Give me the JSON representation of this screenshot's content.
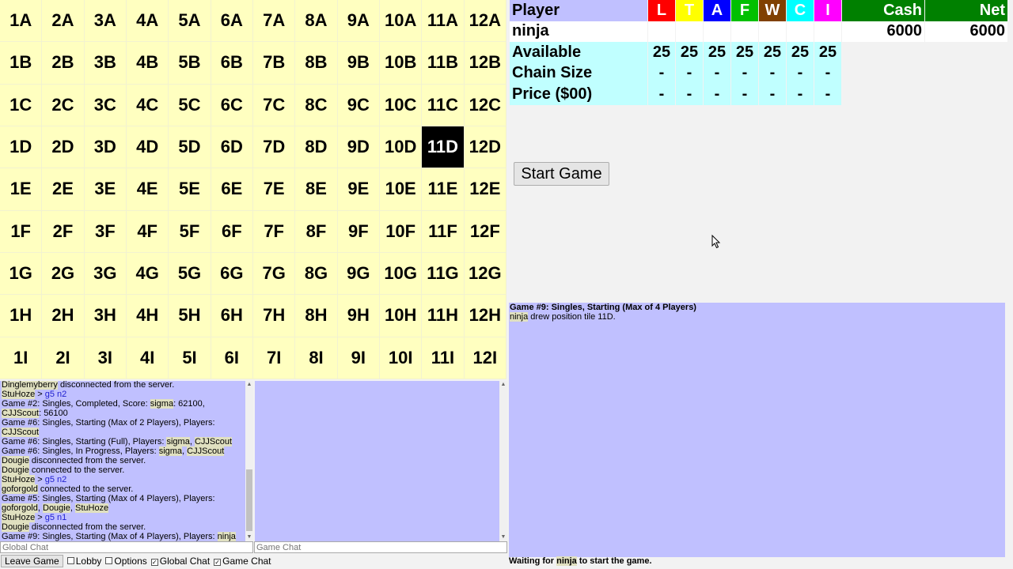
{
  "board": {
    "rows": [
      [
        "1A",
        "2A",
        "3A",
        "4A",
        "5A",
        "6A",
        "7A",
        "8A",
        "9A",
        "10A",
        "11A",
        "12A"
      ],
      [
        "1B",
        "2B",
        "3B",
        "4B",
        "5B",
        "6B",
        "7B",
        "8B",
        "9B",
        "10B",
        "11B",
        "12B"
      ],
      [
        "1C",
        "2C",
        "3C",
        "4C",
        "5C",
        "6C",
        "7C",
        "8C",
        "9C",
        "10C",
        "11C",
        "12C"
      ],
      [
        "1D",
        "2D",
        "3D",
        "4D",
        "5D",
        "6D",
        "7D",
        "8D",
        "9D",
        "10D",
        "11D",
        "12D"
      ],
      [
        "1E",
        "2E",
        "3E",
        "4E",
        "5E",
        "6E",
        "7E",
        "8E",
        "9E",
        "10E",
        "11E",
        "12E"
      ],
      [
        "1F",
        "2F",
        "3F",
        "4F",
        "5F",
        "6F",
        "7F",
        "8F",
        "9F",
        "10F",
        "11F",
        "12F"
      ],
      [
        "1G",
        "2G",
        "3G",
        "4G",
        "5G",
        "6G",
        "7G",
        "8G",
        "9G",
        "10G",
        "11G",
        "12G"
      ],
      [
        "1H",
        "2H",
        "3H",
        "4H",
        "5H",
        "6H",
        "7H",
        "8H",
        "9H",
        "10H",
        "11H",
        "12H"
      ],
      [
        "1I",
        "2I",
        "3I",
        "4I",
        "5I",
        "6I",
        "7I",
        "8I",
        "9I",
        "10I",
        "11I",
        "12I"
      ]
    ],
    "drawn_tile": "11D"
  },
  "score": {
    "player_header": "Player",
    "chains": [
      {
        "letter": "L",
        "color": "#ff0000"
      },
      {
        "letter": "T",
        "color": "#ffff00"
      },
      {
        "letter": "A",
        "color": "#0000ff"
      },
      {
        "letter": "F",
        "color": "#00c000"
      },
      {
        "letter": "W",
        "color": "#804000"
      },
      {
        "letter": "C",
        "color": "#00ffff"
      },
      {
        "letter": "I",
        "color": "#ff00ff"
      }
    ],
    "cash_header": "Cash",
    "net_header": "Net",
    "players": [
      {
        "name": "ninja",
        "holdings": [
          "",
          "",
          "",
          "",
          "",
          "",
          ""
        ],
        "cash": "6000",
        "net": "6000"
      }
    ],
    "rows": [
      {
        "label": "Available",
        "values": [
          "25",
          "25",
          "25",
          "25",
          "25",
          "25",
          "25"
        ]
      },
      {
        "label": "Chain Size",
        "values": [
          "-",
          "-",
          "-",
          "-",
          "-",
          "-",
          "-"
        ]
      },
      {
        "label": "Price ($00)",
        "values": [
          "-",
          "-",
          "-",
          "-",
          "-",
          "-",
          "-"
        ]
      }
    ]
  },
  "start_button": "Start Game",
  "global_chat": [
    [
      {
        "t": "Dinglemyberry",
        "hl": true
      },
      {
        "t": " disconnected from the server."
      }
    ],
    [
      {
        "t": "StuHoze",
        "hl": true
      },
      {
        "t": " > "
      },
      {
        "t": "g5 n2",
        "cmd": true
      }
    ],
    [
      {
        "t": "Game #2: Singles, Completed, Score: "
      },
      {
        "t": "sigma",
        "hl": true
      },
      {
        "t": ": 62100, "
      },
      {
        "t": "CJJScout",
        "hl": true
      },
      {
        "t": ": 56100"
      }
    ],
    [
      {
        "t": "Game #6: Singles, Starting (Max of 2 Players), Players: "
      },
      {
        "t": "CJJScout",
        "hl": true
      }
    ],
    [
      {
        "t": "Game #6: Singles, Starting (Full), Players: "
      },
      {
        "t": "sigma",
        "hl": true
      },
      {
        "t": ", "
      },
      {
        "t": "CJJScout",
        "hl": true
      }
    ],
    [
      {
        "t": "Game #6: Singles, In Progress, Players: "
      },
      {
        "t": "sigma",
        "hl": true
      },
      {
        "t": ", "
      },
      {
        "t": "CJJScout",
        "hl": true
      }
    ],
    [
      {
        "t": "Dougie",
        "hl": true
      },
      {
        "t": " disconnected from the server."
      }
    ],
    [
      {
        "t": "Dougie",
        "hl": true
      },
      {
        "t": " connected to the server."
      }
    ],
    [
      {
        "t": "StuHoze",
        "hl": true
      },
      {
        "t": " > "
      },
      {
        "t": "g5 n2",
        "cmd": true
      }
    ],
    [
      {
        "t": "goforgold",
        "hl": true
      },
      {
        "t": " connected to the server."
      }
    ],
    [
      {
        "t": "Game #5: Singles, Starting (Max of 4 Players), Players: "
      },
      {
        "t": "goforgold",
        "hl": true
      },
      {
        "t": ", "
      },
      {
        "t": "Dougie",
        "hl": true
      },
      {
        "t": ", "
      },
      {
        "t": "StuHoze",
        "hl": true
      }
    ],
    [
      {
        "t": "StuHoze",
        "hl": true
      },
      {
        "t": " > "
      },
      {
        "t": "g5 n1",
        "cmd": true
      }
    ],
    [
      {
        "t": "Dougie",
        "hl": true
      },
      {
        "t": " disconnected from the server."
      }
    ],
    [
      {
        "t": "Game #9: Singles, Starting (Max of 4 Players), Players: "
      },
      {
        "t": "ninja",
        "hl": true
      }
    ]
  ],
  "game_log": [
    [
      {
        "t": "Game #9: Singles, Starting (Max of 4 Players)",
        "bold": true
      }
    ],
    [
      {
        "t": "ninja",
        "hl": true
      },
      {
        "t": " drew position tile 11D."
      }
    ]
  ],
  "global_placeholder": "Global Chat",
  "game_placeholder": "Game Chat",
  "bottom": {
    "leave": "Leave Game",
    "options": [
      {
        "label": "Lobby",
        "checked": false
      },
      {
        "label": "Options",
        "checked": false
      },
      {
        "label": "Global Chat",
        "checked": true
      },
      {
        "label": "Game Chat",
        "checked": true
      }
    ]
  },
  "status": [
    {
      "t": "Waiting for "
    },
    {
      "t": "ninja",
      "hl": true
    },
    {
      "t": " to start the game."
    }
  ]
}
